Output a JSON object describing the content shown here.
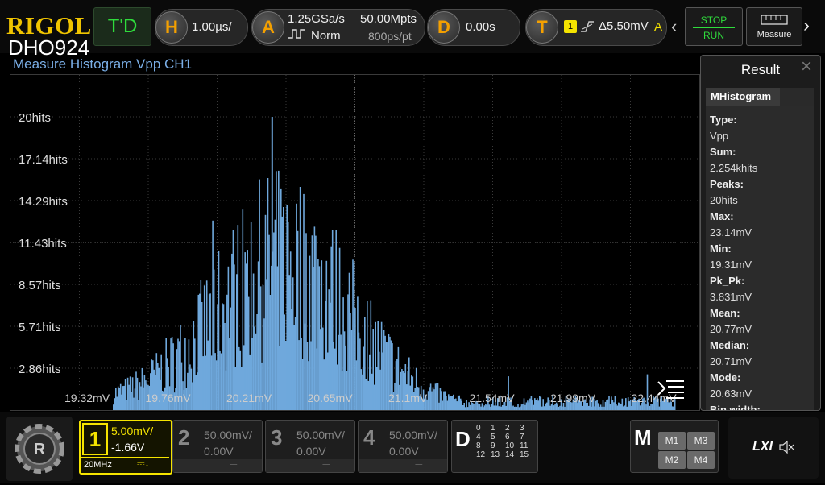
{
  "brand": {
    "logo": "RIGOL",
    "model": "DHO924"
  },
  "topbar": {
    "trigger_mode": "T'D",
    "horizontal": {
      "letter": "H",
      "timebase": "1.00µs/"
    },
    "acquire": {
      "letter": "A",
      "sample_rate": "1.25GSa/s",
      "mode": "Norm",
      "memory_depth": "50.00Mpts",
      "points_per_div": "800ps/pt"
    },
    "delay": {
      "letter": "D",
      "value": "0.00s"
    },
    "trigger": {
      "letter": "T",
      "source": "1",
      "level": "Δ5.50mV",
      "coupling": "A"
    },
    "stop_label": "STOP",
    "run_label": "RUN",
    "measure_label": "Measure"
  },
  "plot": {
    "title": "Measure Histogram  Vpp  CH1",
    "bar_color": "#6fa8dc"
  },
  "chart_data": {
    "type": "bar",
    "title": "Measure Histogram  Vpp  CH1",
    "yticks": [
      "20hits",
      "17.14hits",
      "14.29hits",
      "11.43hits",
      "8.57hits",
      "5.71hits",
      "2.86hits"
    ],
    "ytick_values": [
      20,
      17.14,
      14.29,
      11.43,
      8.57,
      5.71,
      2.86
    ],
    "xticks": [
      "19.32mV",
      "19.76mV",
      "20.21mV",
      "20.65mV",
      "21.1mV",
      "21.54mV",
      "21.99mV",
      "22.44mV"
    ],
    "xlim": [
      19.1,
      23.14
    ],
    "ylim": [
      0,
      22.86
    ],
    "peak": {
      "x": 20.63,
      "y": 20
    },
    "grid": true
  },
  "result": {
    "title": "Result",
    "tab": "MHistogram",
    "items": [
      {
        "key": "Type:",
        "value": "Vpp"
      },
      {
        "key": "Sum:",
        "value": "2.254khits"
      },
      {
        "key": "Peaks:",
        "value": "20hits"
      },
      {
        "key": "Max:",
        "value": "23.14mV"
      },
      {
        "key": "Min:",
        "value": "19.31mV"
      },
      {
        "key": "Pk_Pk:",
        "value": "3.831mV"
      },
      {
        "key": "Mean:",
        "value": "20.77mV"
      },
      {
        "key": "Median:",
        "value": "20.71mV"
      },
      {
        "key": "Mode:",
        "value": "20.63mV"
      },
      {
        "key": "Bin width:",
        "value": ""
      }
    ]
  },
  "channels": [
    {
      "num": "1",
      "scale": "5.00mV/",
      "offset": "-1.66V",
      "bw": "20MHz",
      "color": "#f5e400",
      "active": true
    },
    {
      "num": "2",
      "scale": "50.00mV/",
      "offset": "0.00V",
      "color": "#777"
    },
    {
      "num": "3",
      "scale": "50.00mV/",
      "offset": "0.00V",
      "color": "#777"
    },
    {
      "num": "4",
      "scale": "50.00mV/",
      "offset": "0.00V",
      "color": "#777"
    }
  ],
  "digital": {
    "letter": "D",
    "grid": [
      [
        "0",
        "1",
        "2",
        "3"
      ],
      [
        "4",
        "5",
        "6",
        "7"
      ],
      [
        "8",
        "9",
        "10",
        "11"
      ],
      [
        "12",
        "13",
        "14",
        "15"
      ]
    ]
  },
  "math": {
    "letter": "M",
    "buttons": [
      "M1",
      "M3",
      "M2",
      "M4"
    ]
  },
  "lxi": {
    "label": "LXI"
  }
}
